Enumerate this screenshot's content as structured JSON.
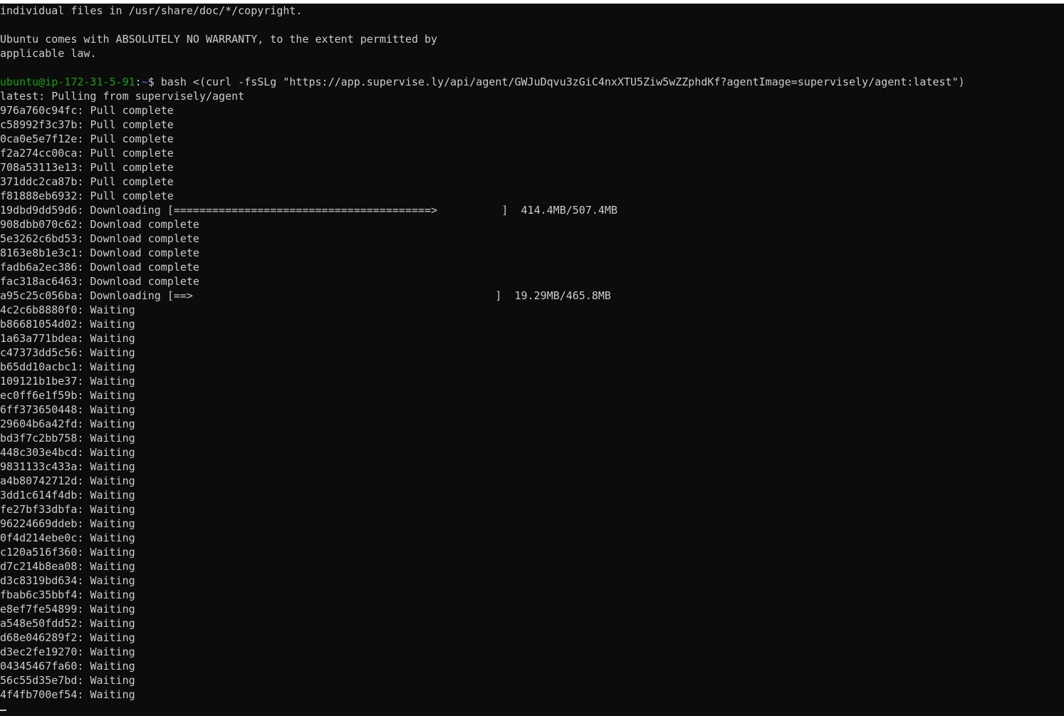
{
  "colors": {
    "background": "#0c0c0c",
    "foreground": "#cccccc",
    "prompt_user": "#13a10e",
    "prompt_path": "#3b78ff"
  },
  "motd": [
    "individual files in /usr/share/doc/*/copyright.",
    "",
    "Ubuntu comes with ABSOLUTELY NO WARRANTY, to the extent permitted by",
    "applicable law.",
    ""
  ],
  "prompt": {
    "user_host": "ubuntu@ip-172-31-5-91",
    "separator": ":",
    "path": "~",
    "symbol": "$ ",
    "command": "bash <(curl -fsSLg \"https://app.supervise.ly/api/agent/GWJuDqvu3zGiC4nxXTU5Ziw5wZZphdKf?agentImage=supervisely/agent:latest\")"
  },
  "pull_header": "latest: Pulling from supervisely/agent",
  "layers": [
    {
      "id": "976a760c94fc",
      "status": "Pull complete"
    },
    {
      "id": "c58992f3c37b",
      "status": "Pull complete"
    },
    {
      "id": "0ca0e5e7f12e",
      "status": "Pull complete"
    },
    {
      "id": "f2a274cc00ca",
      "status": "Pull complete"
    },
    {
      "id": "708a53113e13",
      "status": "Pull complete"
    },
    {
      "id": "371ddc2ca87b",
      "status": "Pull complete"
    },
    {
      "id": "f81888eb6932",
      "status": "Pull complete"
    },
    {
      "id": "19dbd9dd59d6",
      "status": "Downloading",
      "bar": "[========================================>          ]",
      "size": "414.4MB/507.4MB"
    },
    {
      "id": "908dbb070c62",
      "status": "Download complete"
    },
    {
      "id": "5e3262c6bd53",
      "status": "Download complete"
    },
    {
      "id": "8163e8b1e3c1",
      "status": "Download complete"
    },
    {
      "id": "fadb6a2ec386",
      "status": "Download complete"
    },
    {
      "id": "fac318ac6463",
      "status": "Download complete"
    },
    {
      "id": "a95c25c056ba",
      "status": "Downloading",
      "bar": "[==>                                               ]",
      "size": "19.29MB/465.8MB"
    },
    {
      "id": "4c2c6b8880f0",
      "status": "Waiting"
    },
    {
      "id": "b86681054d02",
      "status": "Waiting"
    },
    {
      "id": "1a63a771bdea",
      "status": "Waiting"
    },
    {
      "id": "c47373dd5c56",
      "status": "Waiting"
    },
    {
      "id": "b65dd10acbc1",
      "status": "Waiting"
    },
    {
      "id": "109121b1be37",
      "status": "Waiting"
    },
    {
      "id": "ec0ff6e1f59b",
      "status": "Waiting"
    },
    {
      "id": "6ff373650448",
      "status": "Waiting"
    },
    {
      "id": "29604b6a42fd",
      "status": "Waiting"
    },
    {
      "id": "bd3f7c2bb758",
      "status": "Waiting"
    },
    {
      "id": "448c303e4bcd",
      "status": "Waiting"
    },
    {
      "id": "9831133c433a",
      "status": "Waiting"
    },
    {
      "id": "a4b80742712d",
      "status": "Waiting"
    },
    {
      "id": "3dd1c614f4db",
      "status": "Waiting"
    },
    {
      "id": "fe27bf33dbfa",
      "status": "Waiting"
    },
    {
      "id": "96224669ddeb",
      "status": "Waiting"
    },
    {
      "id": "0f4d214ebe0c",
      "status": "Waiting"
    },
    {
      "id": "c120a516f360",
      "status": "Waiting"
    },
    {
      "id": "d7c214b8ea08",
      "status": "Waiting"
    },
    {
      "id": "d3c8319bd634",
      "status": "Waiting"
    },
    {
      "id": "fbab6c35bbf4",
      "status": "Waiting"
    },
    {
      "id": "e8ef7fe54899",
      "status": "Waiting"
    },
    {
      "id": "a548e50fdd52",
      "status": "Waiting"
    },
    {
      "id": "d68e046289f2",
      "status": "Waiting"
    },
    {
      "id": "d3ec2fe19270",
      "status": "Waiting"
    },
    {
      "id": "04345467fa60",
      "status": "Waiting"
    },
    {
      "id": "56c55d35e7bd",
      "status": "Waiting"
    },
    {
      "id": "4f4fb700ef54",
      "status": "Waiting"
    }
  ]
}
